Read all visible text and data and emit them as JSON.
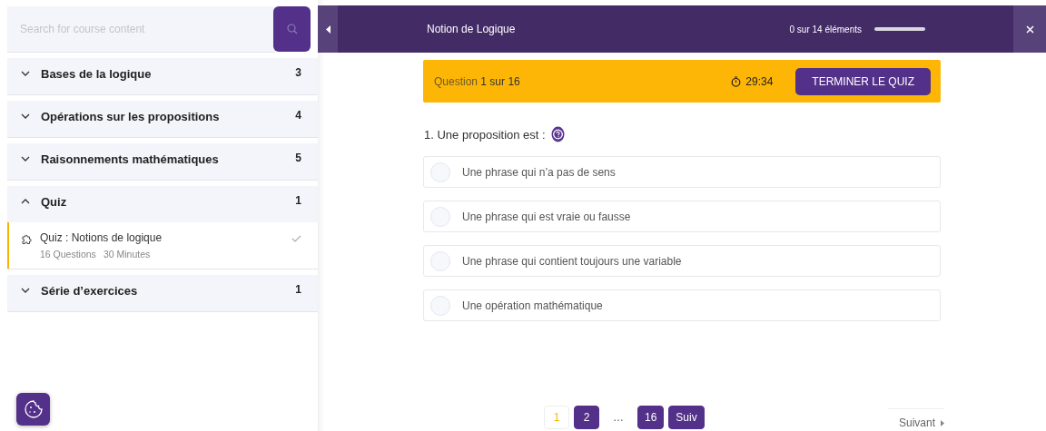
{
  "sidebar": {
    "search": {
      "placeholder": "Search for course content"
    },
    "sections": [
      {
        "title": "Bases de la logique",
        "count": "3",
        "expanded": false
      },
      {
        "title": "Opérations sur les propositions",
        "count": "4",
        "expanded": false
      },
      {
        "title": "Raisonnements mathématiques",
        "count": "5",
        "expanded": false
      },
      {
        "title": "Quiz",
        "count": "1",
        "expanded": true,
        "items": [
          {
            "title": "Quiz : Notions de logique",
            "questions": "16 Questions",
            "duration": "30 Minutes",
            "completed": true,
            "selected": true
          }
        ]
      },
      {
        "title": "Série d’exercices",
        "count": "1",
        "expanded": false
      }
    ]
  },
  "header": {
    "title": "Notion de Logique",
    "progress_text": "0 sur 14 éléments",
    "level": 0
  },
  "quiz_bar": {
    "label": "Question",
    "position": "1 sur 16",
    "timer": "29:34",
    "finish_button": "TERMINER LE QUIZ"
  },
  "question": {
    "text": "1. Une proposition est :",
    "options": [
      {
        "text": "Une phrase qui n’a pas de sens",
        "selected": false
      },
      {
        "text": "Une phrase qui est vraie ou fausse",
        "selected": false
      },
      {
        "text": "Une phrase qui contient toujours une variable",
        "selected": false
      },
      {
        "text": "Une opération mathématique",
        "selected": false
      }
    ]
  },
  "pagination": {
    "pages": [
      {
        "label": "1",
        "selected": true
      },
      {
        "label": "2",
        "selected": false
      },
      {
        "label": "16",
        "selected": false
      }
    ],
    "ellipsis": "…",
    "next": "Suiv"
  },
  "next_link": "Suivant"
}
